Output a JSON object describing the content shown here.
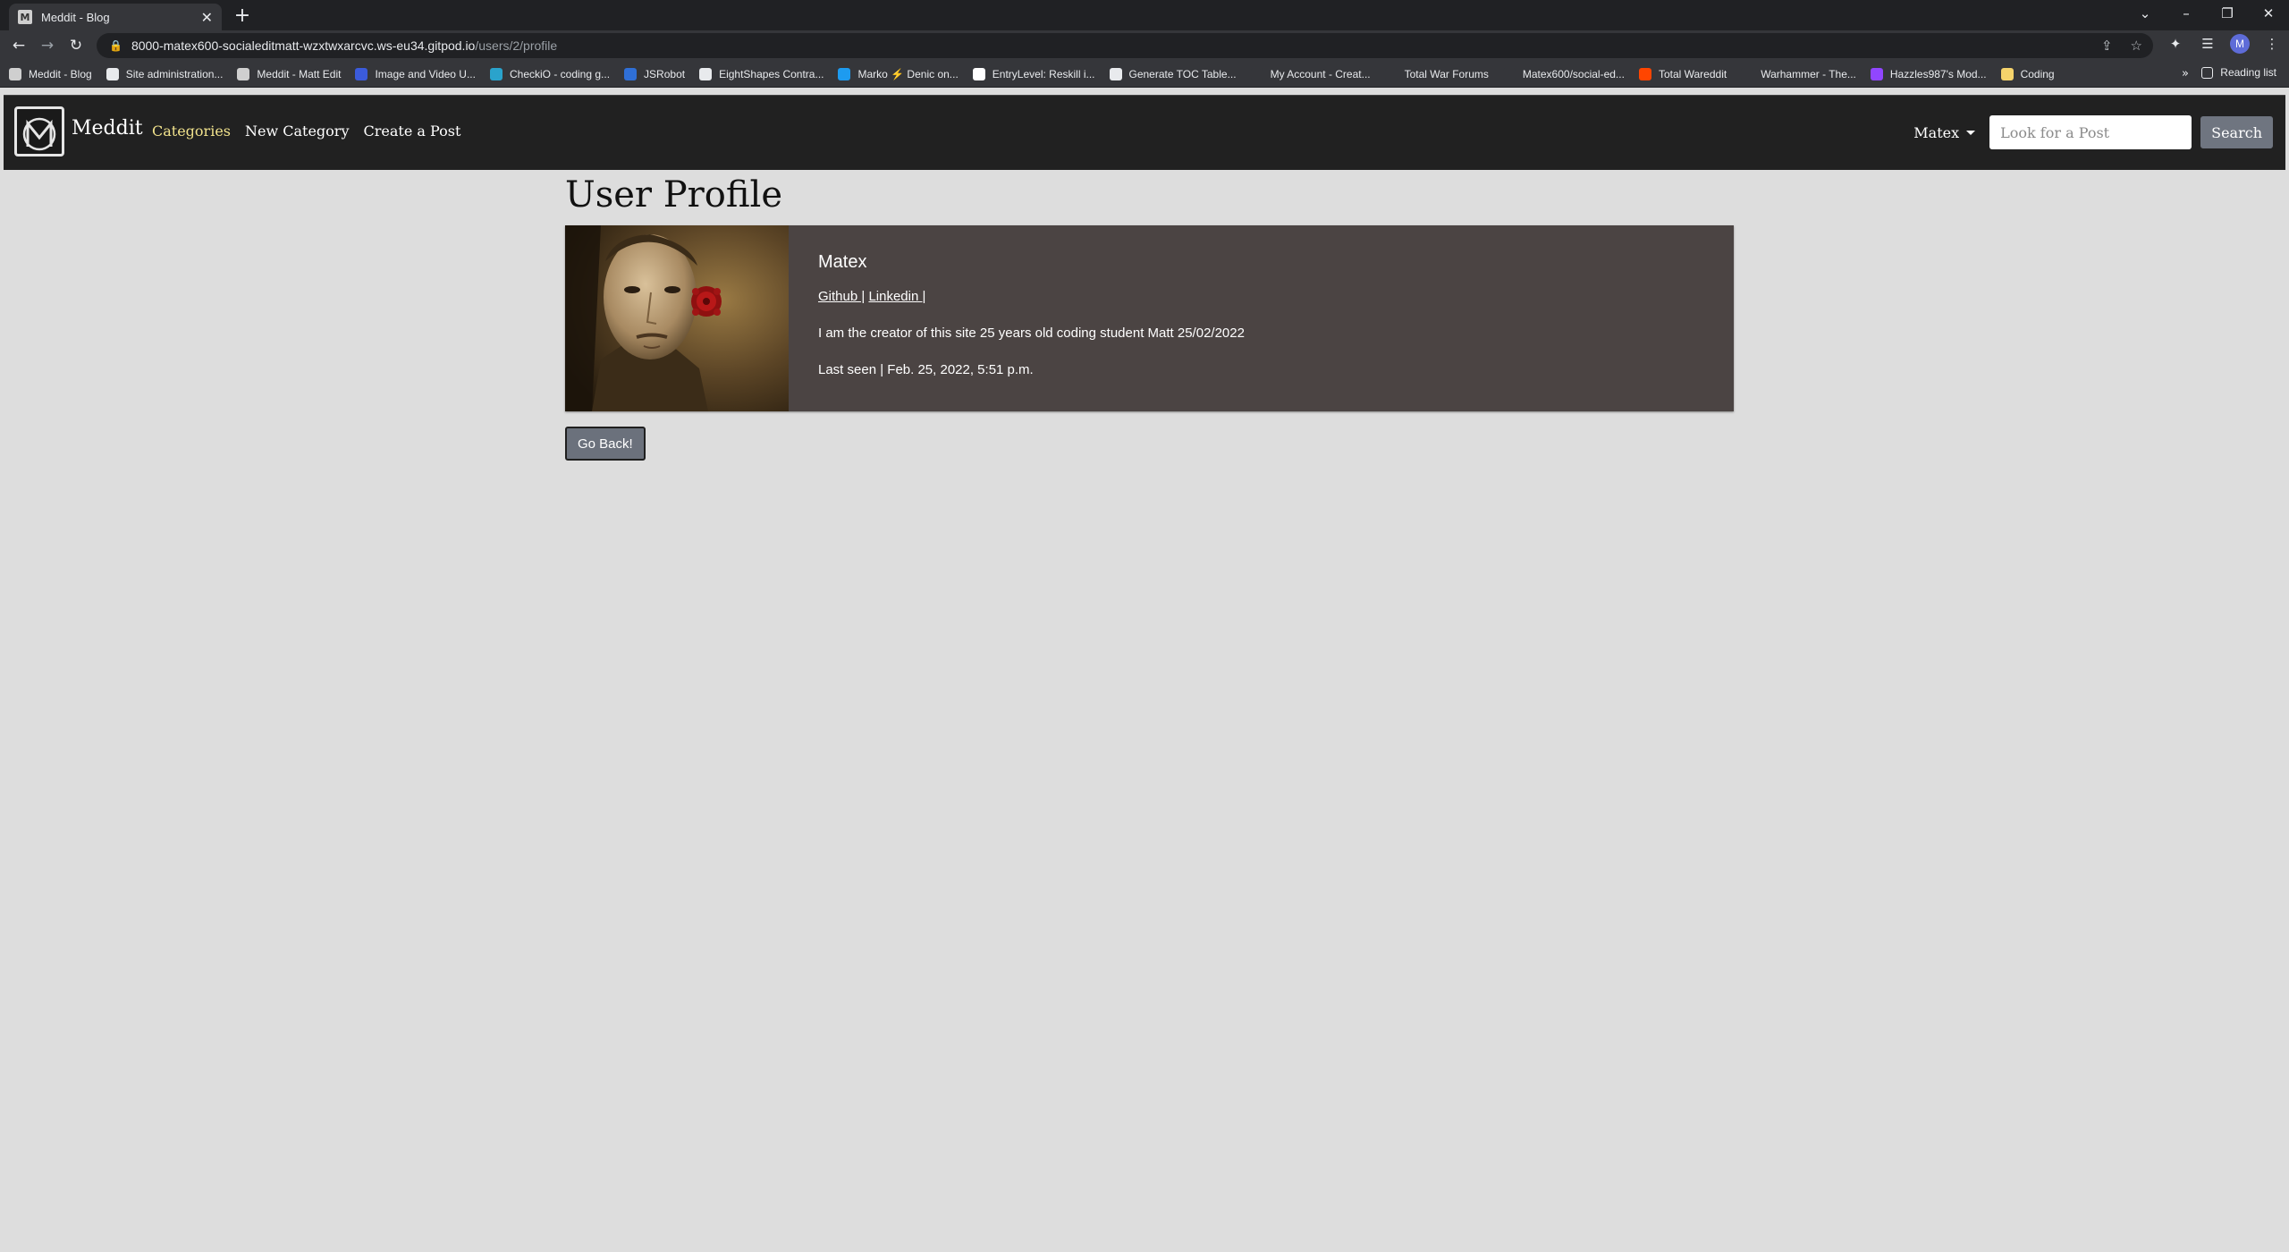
{
  "browser": {
    "tab_title": "Meddit - Blog",
    "tab_favicon": "M",
    "url_host": "8000-matex600-socialeditmatt-wzxtwxarcvc.ws-eu34.gitpod.io",
    "url_path": "/users/2/profile",
    "profile_initial": "M",
    "bookmarks": [
      {
        "label": "Meddit - Blog",
        "icon": "meddit-icon",
        "color": "#cfcfcf"
      },
      {
        "label": "Site administration...",
        "icon": "django-icon",
        "color": "#e8eaed"
      },
      {
        "label": "Meddit - Matt Edit",
        "icon": "meddit-icon",
        "color": "#cfcfcf"
      },
      {
        "label": "Image and Video U...",
        "icon": "image-icon",
        "color": "#3b5bdb"
      },
      {
        "label": "CheckiO - coding g...",
        "icon": "checkio-icon",
        "color": "#2aa3cc"
      },
      {
        "label": "JSRobot",
        "icon": "jsrobot-icon",
        "color": "#2f6fd6"
      },
      {
        "label": "EightShapes Contra...",
        "icon": "globe-icon",
        "color": "#e8eaed"
      },
      {
        "label": "Marko ⚡ Denic on...",
        "icon": "twitter-icon",
        "color": "#1d9bf0"
      },
      {
        "label": "EntryLevel: Reskill i...",
        "icon": "entrylevel-icon",
        "color": "#ffffff"
      },
      {
        "label": "Generate TOC Table...",
        "icon": "globe-icon",
        "color": "#e8eaed"
      },
      {
        "label": "My Account - Creat...",
        "icon": "c-icon",
        "color": "#35363a"
      },
      {
        "label": "Total War Forums",
        "icon": "totalwar-icon",
        "color": "#35363a"
      },
      {
        "label": "Matex600/social-ed...",
        "icon": "github-icon",
        "color": "#35363a"
      },
      {
        "label": "Total Wareddit",
        "icon": "reddit-icon",
        "color": "#ff4500"
      },
      {
        "label": "Warhammer - The...",
        "icon": "warhammer-icon",
        "color": "#35363a"
      },
      {
        "label": "Hazzles987's Mod...",
        "icon": "twitch-icon",
        "color": "#9146ff"
      },
      {
        "label": "Coding",
        "icon": "folder-icon",
        "color": "#f5d36b"
      }
    ],
    "overflow_label": "»",
    "reading_list": "Reading list"
  },
  "navbar": {
    "brand": "Meddit",
    "links": [
      {
        "label": "Categories",
        "active": true
      },
      {
        "label": "New Category",
        "active": false
      },
      {
        "label": "Create a Post",
        "active": false
      }
    ],
    "user": "Matex",
    "search_placeholder": "Look for a Post",
    "search_button": "Search"
  },
  "profile": {
    "heading": "User Profile",
    "username": "Matex",
    "github_label": "Github |",
    "linkedin_label": "Linkedin |",
    "bio": "I am the creator of this site 25 years old coding student Matt 25/02/2022",
    "last_seen": "Last seen | Feb. 25, 2022, 5:51 p.m."
  },
  "actions": {
    "back_label": "Go Back!"
  }
}
